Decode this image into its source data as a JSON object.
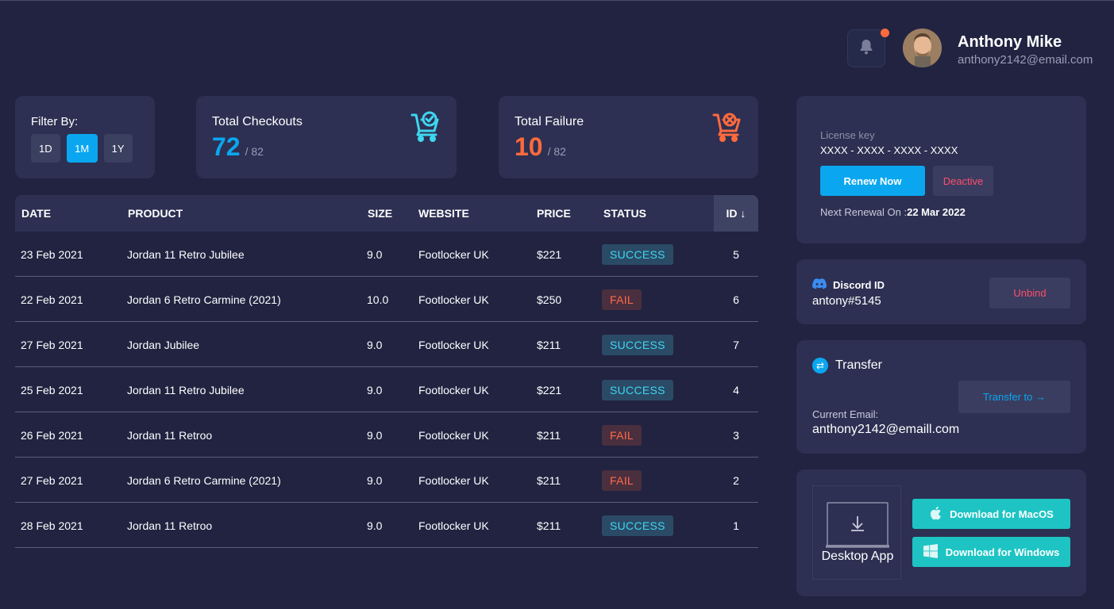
{
  "header": {
    "user_name": "Anthony Mike",
    "user_email": "anthony2142@email.com"
  },
  "filter": {
    "title": "Filter By:",
    "options": [
      "1D",
      "1M",
      "1Y"
    ],
    "selected": "1M"
  },
  "stats": {
    "checkouts": {
      "label": "Total Checkouts",
      "value": "72",
      "total": "/ 82",
      "color": "#0aa7f0"
    },
    "failure": {
      "label": "Total Failure",
      "value": "10",
      "total": "/ 82",
      "color": "#ff6a3d"
    }
  },
  "table": {
    "columns": [
      "DATE",
      "PRODUCT",
      "SIZE",
      "WEBSITE",
      "PRICE",
      "STATUS",
      "ID ↓"
    ],
    "rows": [
      {
        "date": "23 Feb 2021",
        "product": "Jordan 11 Retro Jubilee",
        "size": "9.0",
        "website": "Footlocker UK",
        "price": "$221",
        "status": "SUCCESS",
        "id": "5"
      },
      {
        "date": "22 Feb 2021",
        "product": "Jordan 6 Retro Carmine (2021)",
        "size": "10.0",
        "website": "Footlocker UK",
        "price": "$250",
        "status": "FAIL",
        "id": "6"
      },
      {
        "date": "27 Feb 2021",
        "product": "Jordan Jubilee",
        "size": "9.0",
        "website": "Footlocker UK",
        "price": "$211",
        "status": "SUCCESS",
        "id": "7"
      },
      {
        "date": "25 Feb 2021",
        "product": "Jordan 11 Retro Jubilee",
        "size": "9.0",
        "website": "Footlocker UK",
        "price": "$221",
        "status": "SUCCESS",
        "id": "4"
      },
      {
        "date": "26 Feb 2021",
        "product": "Jordan 11 Retroo",
        "size": "9.0",
        "website": "Footlocker UK",
        "price": "$211",
        "status": "FAIL",
        "id": "3"
      },
      {
        "date": "27 Feb 2021",
        "product": "Jordan 6 Retro Carmine (2021)",
        "size": "9.0",
        "website": "Footlocker UK",
        "price": "$211",
        "status": "FAIL",
        "id": "2"
      },
      {
        "date": "28 Feb 2021",
        "product": "Jordan 11 Retroo",
        "size": "9.0",
        "website": "Footlocker UK",
        "price": "$211",
        "status": "SUCCESS",
        "id": "1"
      }
    ]
  },
  "license": {
    "label": "License key",
    "value": "XXXX - XXXX - XXXX - XXXX",
    "renew_label": "Renew Now",
    "deactive_label": "Deactive",
    "next_renewal_label": "Next Renewal On :",
    "next_renewal_date": "22 Mar 2022"
  },
  "discord": {
    "title": "Discord ID",
    "value": "antony#5145",
    "unbind_label": "Unbind"
  },
  "transfer": {
    "title": "Transfer",
    "button_label": "Transfer to →",
    "current_email_label": "Current Email:",
    "current_email": "anthony2142@emaill.com"
  },
  "download": {
    "desktop_label": "Desktop App",
    "mac_label": "Download for MacOS",
    "windows_label": "Download for Windows"
  },
  "colors": {
    "background": "#212341",
    "card": "#2d3052",
    "accent_blue": "#0aa7f0",
    "accent_orange": "#ff6a3d",
    "success_text": "#3fd6f0",
    "fail_text": "#ff6a4a",
    "danger": "#ff4d6d",
    "teal": "#1ec4c4"
  },
  "icons": {
    "notification": "bell-icon",
    "checkout": "cart-check-icon",
    "failure": "cart-x-icon",
    "discord": "discord-icon",
    "transfer": "transfer-arrows-icon",
    "download": "download-icon",
    "apple": "apple-icon",
    "windows": "windows-icon"
  }
}
